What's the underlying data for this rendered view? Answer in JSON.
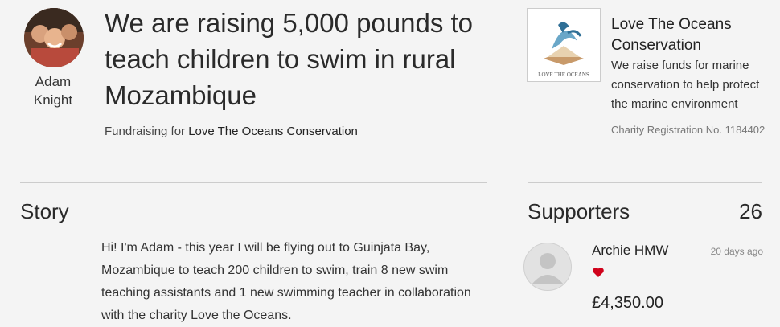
{
  "owner": {
    "name": "Adam\nKnight",
    "avatar_icon": "group-photo-avatar"
  },
  "page": {
    "title": "We are raising 5,000 pounds to teach children to swim in rural Mozambique",
    "fundraising_prefix": "Fundraising for ",
    "fundraising_charity": "Love The Oceans Conservation"
  },
  "charity": {
    "name": "Love The Oceans Conservation",
    "description": "We raise funds for marine conservation to help protect the marine environment",
    "registration": "Charity Registration No. 1184402",
    "logo_text": "LOVE THE OCEANS"
  },
  "story": {
    "heading": "Story",
    "text": "Hi! I'm Adam - this year I will be flying out to Guinjata Bay, Mozambique to teach 200 children to swim, train 8 new swim teaching assistants and 1 new swimming teacher in collaboration with the charity Love the Oceans."
  },
  "supporters": {
    "heading": "Supporters",
    "count": "26",
    "items": [
      {
        "name": "Archie HMW",
        "time": "20 days ago",
        "amount": "£4,350.00",
        "icon": "heart-icon"
      }
    ]
  },
  "colors": {
    "background": "#f4f4f4",
    "heart": "#d0021b",
    "divider": "#cccccc"
  }
}
